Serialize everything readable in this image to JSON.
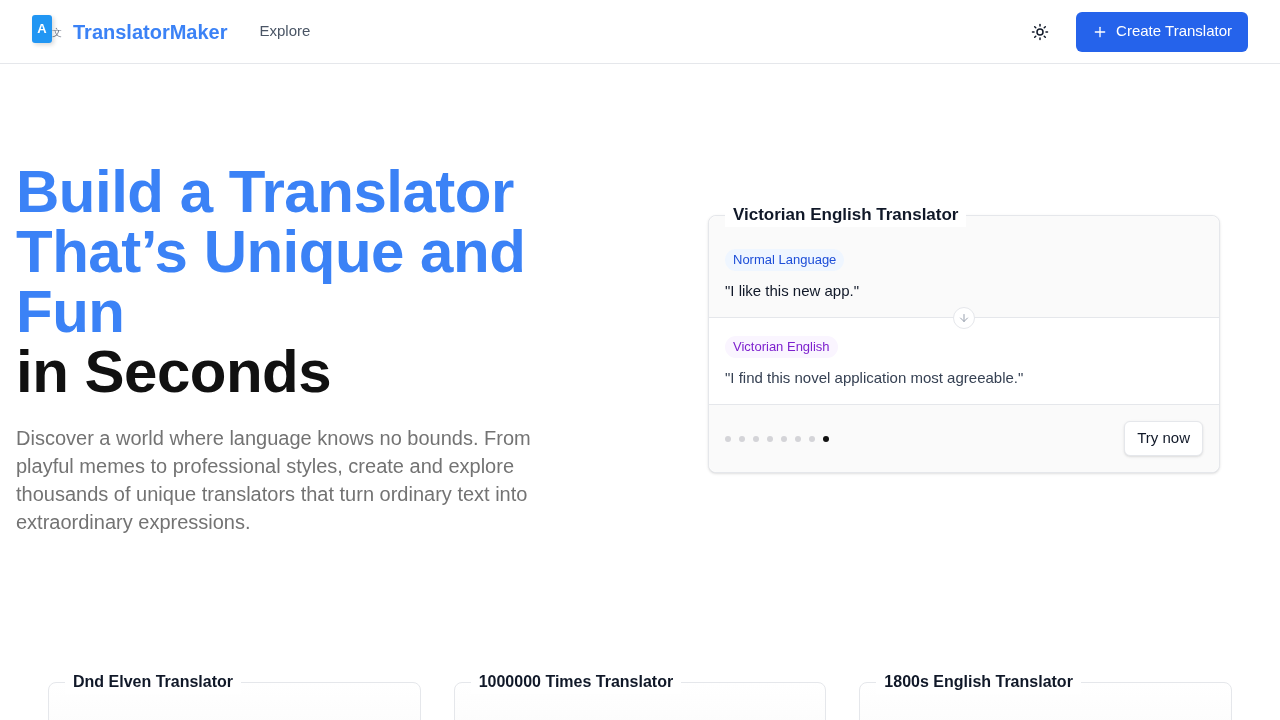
{
  "header": {
    "logo": {
      "mark": "A",
      "mark_secondary": "文",
      "name": "TranslatorMaker"
    },
    "nav": [
      {
        "label": "Explore"
      }
    ],
    "create_button": {
      "label": "Create Translator"
    }
  },
  "hero": {
    "title_highlight": "Build a Translator That’s Unique and Fun",
    "title_rest": "in Seconds",
    "description": "Discover a world where language knows no bounds. From playful memes to professional styles, create and explore thousands of unique translators that turn ordinary text into extraordinary expressions."
  },
  "sample_card": {
    "title": "Victorian English Translator",
    "source": {
      "label": "Normal Language",
      "text": "\"I like this new app.\""
    },
    "target": {
      "label": "Victorian English",
      "text": "\"I find this novel application most agreeable.\""
    },
    "slides": [
      {
        "selected": false
      },
      {
        "selected": false
      },
      {
        "selected": false
      },
      {
        "selected": false
      },
      {
        "selected": false
      },
      {
        "selected": false
      },
      {
        "selected": false
      },
      {
        "selected": true
      }
    ],
    "button": "Try now"
  },
  "translator_cards": [
    {
      "title": "Dnd Elven Translator"
    },
    {
      "title": "1000000 Times Translator"
    },
    {
      "title": "1800s English Translator"
    }
  ]
}
